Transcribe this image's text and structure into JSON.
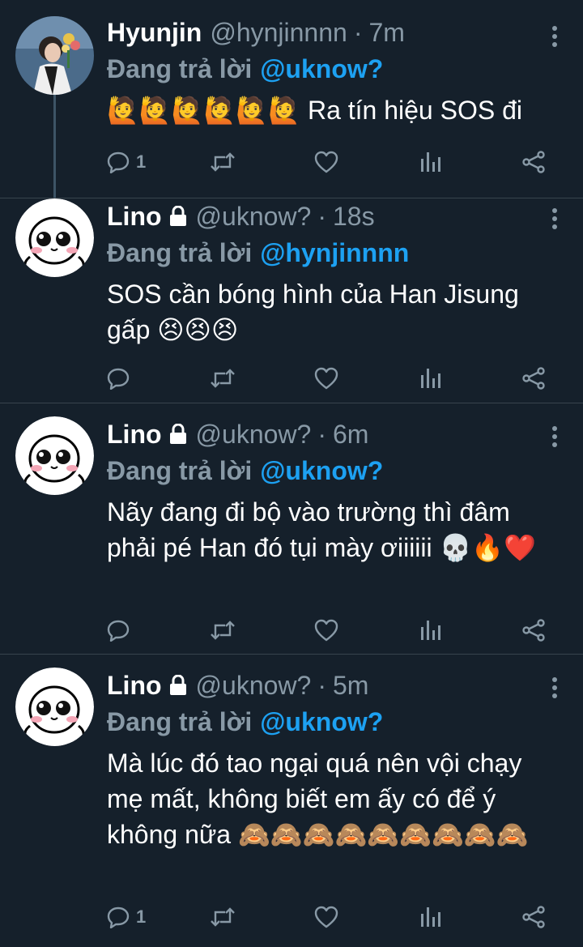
{
  "tweets": [
    {
      "name": "Hyunjin",
      "handle": "@hynjinnnn",
      "time": "7m",
      "reply_label": "Đang trả lời",
      "reply_to": "@uknow?",
      "text": "🙋🙋🙋🙋🙋🙋 Ra tín hiệu SOS đi",
      "reply_count": "1",
      "locked": false
    },
    {
      "name": "Lino",
      "handle": "@uknow?",
      "time": "18s",
      "reply_label": "Đang trả lời",
      "reply_to": "@hynjinnnn",
      "text": "SOS cần bóng hình của Han Jisung gấp 😣😣😣",
      "reply_count": "",
      "locked": true
    },
    {
      "name": "Lino",
      "handle": "@uknow?",
      "time": "6m",
      "reply_label": "Đang trả lời",
      "reply_to": "@uknow?",
      "text": "Nãy đang đi bộ vào trường thì đâm phải pé Han đó tụi mày ơiiiiii 💀🔥❤️",
      "reply_count": "",
      "locked": true
    },
    {
      "name": "Lino",
      "handle": "@uknow?",
      "time": "5m",
      "reply_label": "Đang trả lời",
      "reply_to": "@uknow?",
      "text": "Mà lúc đó tao ngại quá nên vội chạy mẹ mất, không biết em ấy có để ý không nữa 🙈🙈🙈🙈🙈🙈🙈🙈🙈",
      "reply_count": "1",
      "locked": true
    }
  ],
  "separator": "·",
  "colors": {
    "background": "#15202b",
    "divider": "#38444d",
    "secondary_text": "#8899a6",
    "accent": "#1da1f2"
  },
  "icons": {
    "reply": "reply-icon",
    "retweet": "retweet-icon",
    "like": "heart-icon",
    "analytics": "analytics-icon",
    "share": "share-icon",
    "more": "more-vertical-icon",
    "lock": "lock-icon"
  }
}
